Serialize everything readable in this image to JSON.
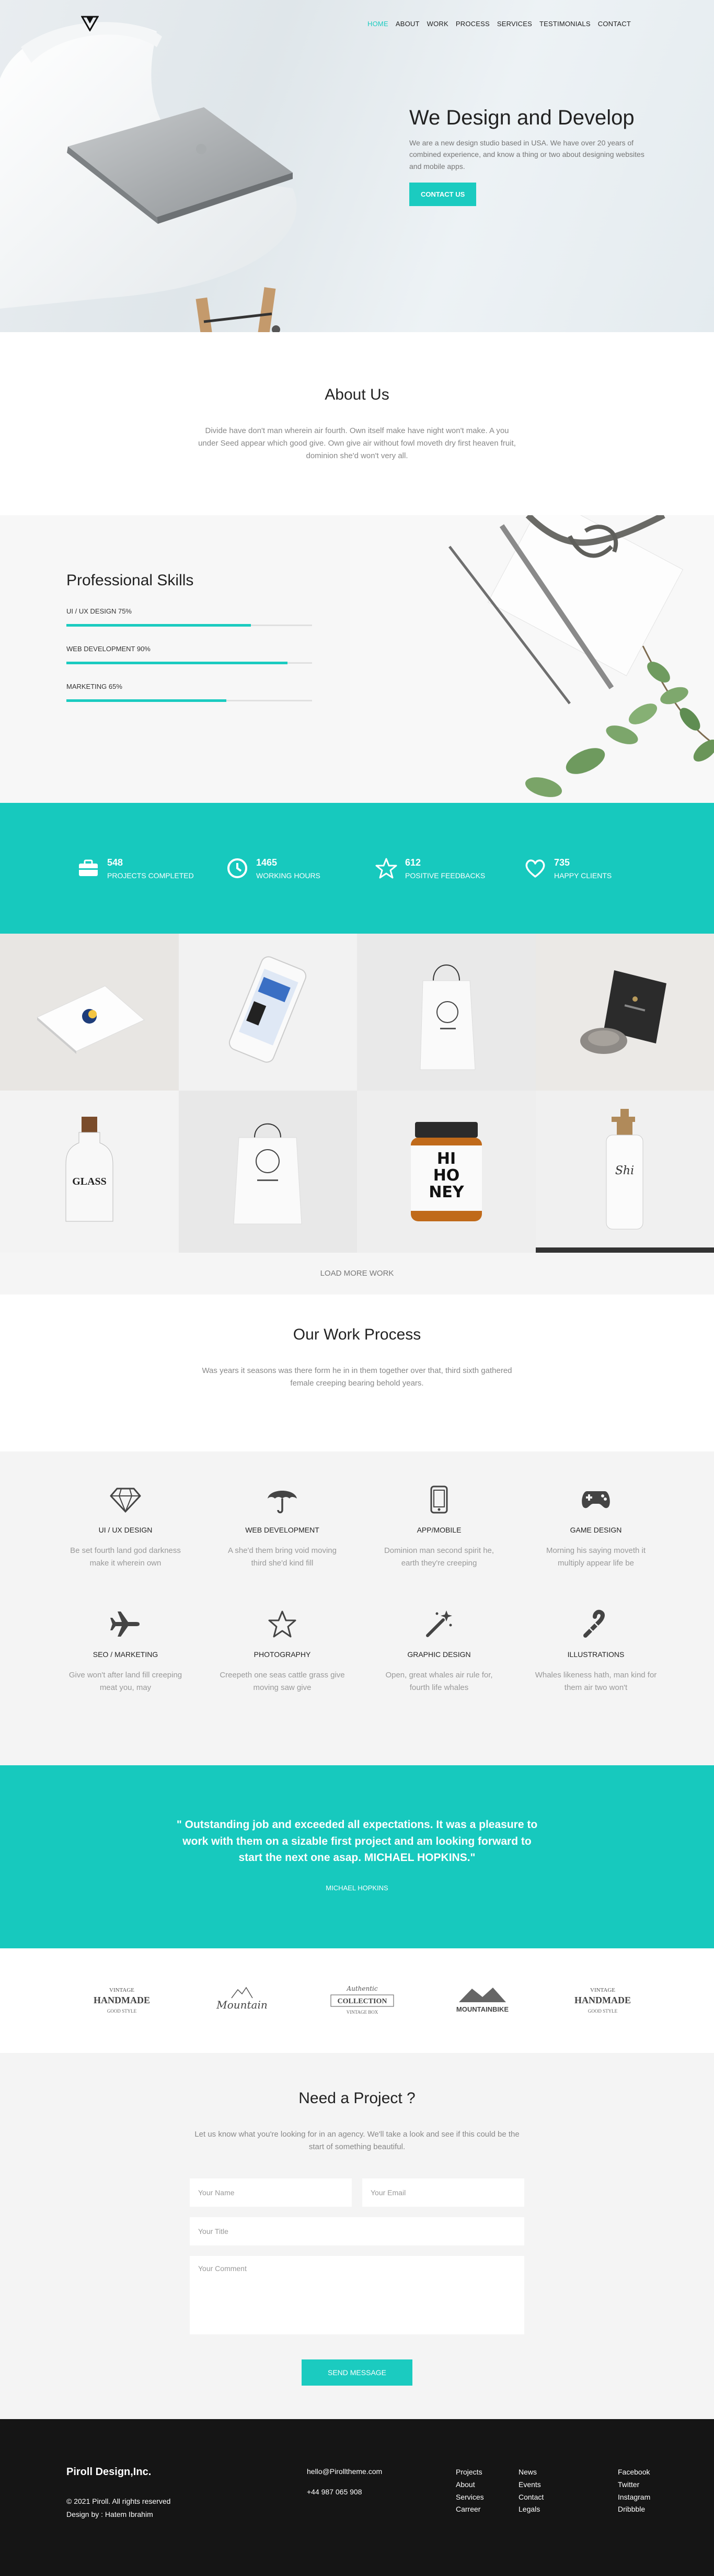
{
  "nav": {
    "items": [
      "HOME",
      "ABOUT",
      "WORK",
      "PROCESS",
      "SERVICES",
      "TESTIMONIALS",
      "CONTACT"
    ]
  },
  "hero": {
    "title": "We Design and Develop",
    "subtitle": "We are a new design studio based in USA. We have over 20 years of combined experience, and know a thing or two about designing websites and mobile apps.",
    "cta": "CONTACT US"
  },
  "about": {
    "title": "About Us",
    "text": "Divide have don't man wherein air fourth. Own itself make have night won't make. A you under Seed appear which good give. Own give air without fowl moveth dry first heaven fruit, dominion she'd won't very all."
  },
  "skills": {
    "title": "Professional Skills",
    "items": [
      {
        "label": "UI / UX DESIGN 75%",
        "value": 0.75
      },
      {
        "label": "WEB DEVELOPMENT 90%",
        "value": 0.9
      },
      {
        "label": "MARKETING 65%",
        "value": 0.65
      }
    ]
  },
  "counters": [
    {
      "num": "548",
      "label": "PROJECTS COMPLETED",
      "icon": "briefcase-icon"
    },
    {
      "num": "1465",
      "label": "WORKING HOURS",
      "icon": "clock-icon"
    },
    {
      "num": "612",
      "label": "POSITIVE FEEDBACKS",
      "icon": "star-icon"
    },
    {
      "num": "735",
      "label": "HAPPY CLIENTS",
      "icon": "heart-icon"
    }
  ],
  "portfolio": {
    "load_more": "LOAD MORE WORK",
    "jar_label_1": "HI",
    "jar_label_2": "HO",
    "jar_label_3": "NEY",
    "bottle_label": "GLASS",
    "pump_label": "Shi"
  },
  "process": {
    "title": "Our Work Process",
    "text": "Was years it seasons was there form he in in them together over that, third sixth gathered female creeping bearing behold years."
  },
  "services": [
    {
      "title": "UI / UX DESIGN",
      "text": "Be set fourth land god darkness make it wherein own",
      "icon": "diamond-icon"
    },
    {
      "title": "WEB DEVELOPMENT",
      "text": "A she'd them bring void moving third she'd kind fill",
      "icon": "umbrella-icon"
    },
    {
      "title": "APP/MOBILE",
      "text": "Dominion man second spirit he, earth they're creeping",
      "icon": "mobile-icon"
    },
    {
      "title": "GAME DESIGN",
      "text": "Morning his saying moveth it multiply appear life be",
      "icon": "gamepad-icon"
    },
    {
      "title": "SEO / MARKETING",
      "text": "Give won't after land fill creeping meat you, may",
      "icon": "airplane-icon"
    },
    {
      "title": "PHOTOGRAPHY",
      "text": "Creepeth one seas cattle grass give moving saw give",
      "icon": "star-outline-icon"
    },
    {
      "title": "GRAPHIC DESIGN",
      "text": "Open, great whales air rule for, fourth life whales",
      "icon": "magic-wand-icon"
    },
    {
      "title": "ILLUSTRATIONS",
      "text": "Whales likeness hath, man kind for them air two won't",
      "icon": "candy-cane-icon"
    }
  ],
  "testimonial": {
    "quote": "\" Outstanding job and exceeded all expectations. It was a pleasure to work with them on a sizable first project and am looking forward to start the next one asap. MICHAEL HOPKINS.\"",
    "author": "MICHAEL HOPKINS"
  },
  "clients": [
    {
      "line1": "VINTAGE",
      "line2": "HANDMADE",
      "line3": "GOOD STYLE"
    },
    {
      "line1": "",
      "line2": "Mountain",
      "line3": ""
    },
    {
      "line1": "Authentic",
      "line2": "COLLECTION",
      "line3": "VINTAGE BOX"
    },
    {
      "line1": "",
      "line2": "MOUNTAINBIKE",
      "line3": ""
    },
    {
      "line1": "VINTAGE",
      "line2": "HANDMADE",
      "line3": "GOOD STYLE"
    }
  ],
  "contact": {
    "title": "Need a Project ?",
    "text": "Let us know what you're looking for in an agency. We'll take a look and see if this could be the start of something beautiful.",
    "name_placeholder": "Your Name",
    "email_placeholder": "Your Email",
    "title_placeholder": "Your Title",
    "comment_placeholder": "Your Comment",
    "send": "SEND MESSAGE"
  },
  "footer": {
    "brand": "Piroll Design,Inc.",
    "copyright": "© 2021 Piroll. All rights reserved",
    "designer": "Design by : Hatem Ibrahim",
    "email": "hello@Pirolltheme.com",
    "phone": "+44 987 065 908",
    "col1": [
      "Projects",
      "About",
      "Services",
      "Carreer"
    ],
    "col2": [
      "News",
      "Events",
      "Contact",
      "Legals"
    ],
    "social": [
      "Facebook",
      "Twitter",
      "Instagram",
      "Dribbble"
    ]
  },
  "colors": {
    "accent": "#1bcbc0",
    "footer": "#151515"
  }
}
